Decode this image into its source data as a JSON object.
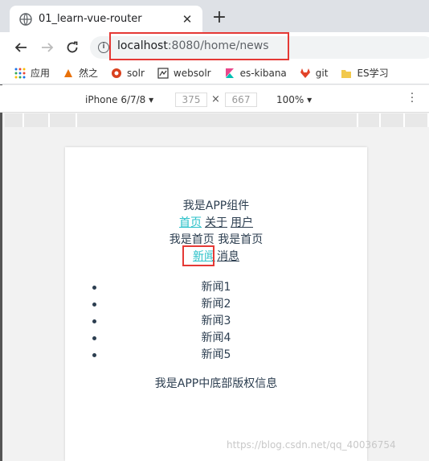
{
  "browser": {
    "tab_title": "01_learn-vue-router",
    "new_tab_symbol": "+",
    "close_symbol": "✕",
    "url_host": "localhost",
    "url_rest": ":8080/home/news",
    "info_symbol": "i"
  },
  "bookmarks": [
    {
      "label": "应用",
      "icon": "apps-grid-icon",
      "color": "#1a73e8"
    },
    {
      "label": "然之",
      "icon": "ranzhi-icon",
      "color": "#e8710a"
    },
    {
      "label": "solr",
      "icon": "solr-icon",
      "color": "#d9411e"
    },
    {
      "label": "websolr",
      "icon": "websolr-icon",
      "color": "#333333"
    },
    {
      "label": "es-kibana",
      "icon": "kibana-icon",
      "color": "#00bfb3"
    },
    {
      "label": "git",
      "icon": "gitlab-icon",
      "color": "#e24329"
    },
    {
      "label": "ES学习",
      "icon": "folder-icon",
      "color": "#f2c94c"
    }
  ],
  "devtools": {
    "device": "iPhone 6/7/8",
    "width": "375",
    "height": "667",
    "times": "×",
    "zoom": "100%"
  },
  "page": {
    "header": "我是APP组件",
    "nav": {
      "home": "首页",
      "about": "关于",
      "user": "用户"
    },
    "home_text": "我是首页 我是首页",
    "sub_nav": {
      "news": "新闻",
      "message": "消息"
    },
    "news": [
      "新闻1",
      "新闻2",
      "新闻3",
      "新闻4",
      "新闻5"
    ],
    "footer": "我是APP中底部版权信息"
  },
  "watermark": "https://blog.csdn.net/qq_40036754",
  "colors": {
    "active_link": "#29c0c8",
    "highlight_box": "#e53935",
    "text": "#2c3e50"
  }
}
